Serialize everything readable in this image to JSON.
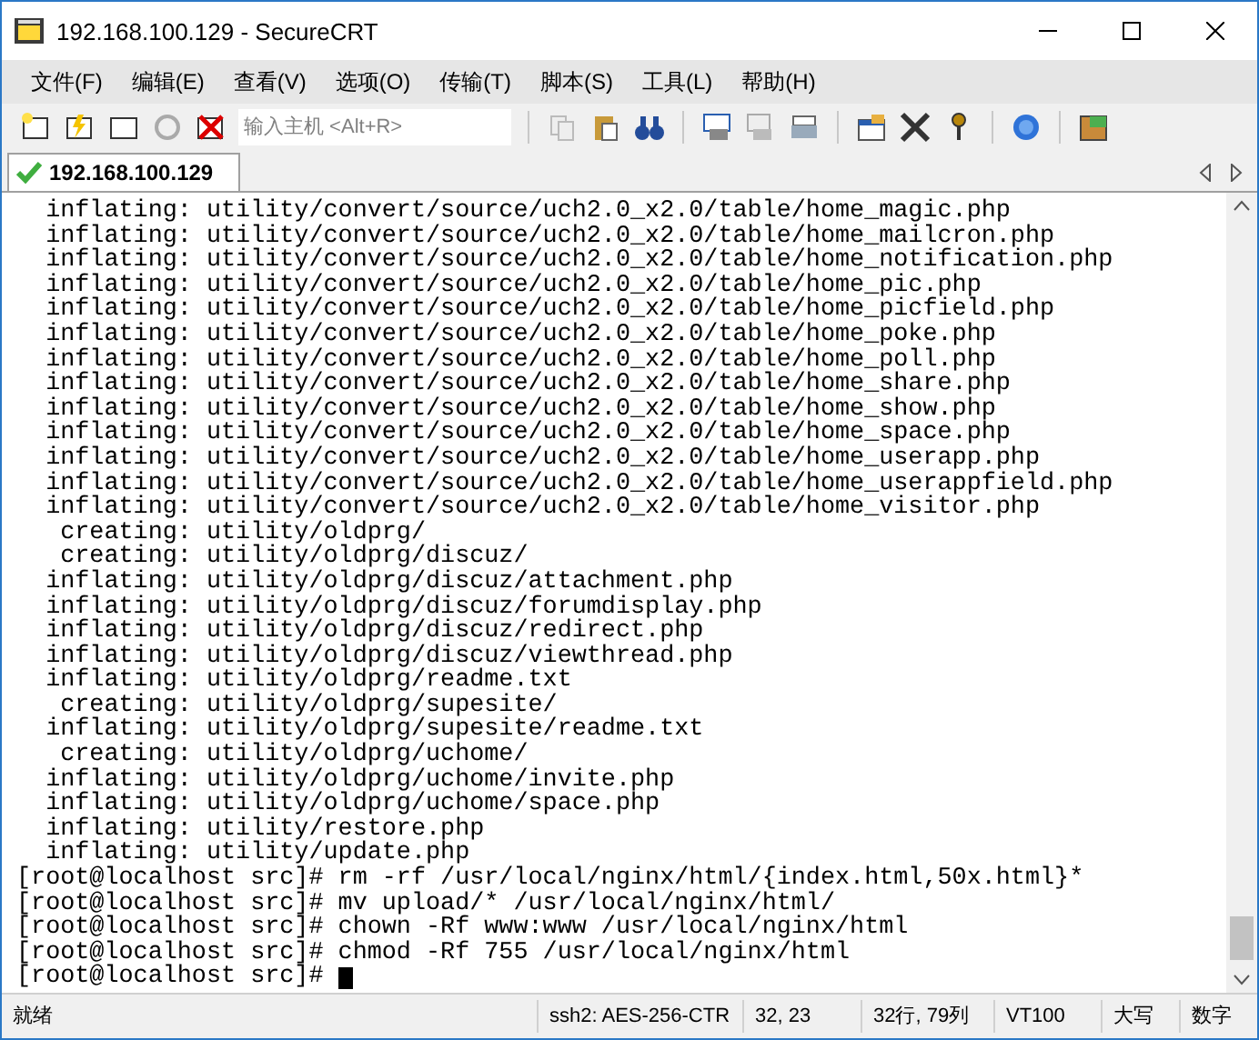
{
  "window": {
    "title": "192.168.100.129 - SecureCRT"
  },
  "menu": [
    "文件(F)",
    "编辑(E)",
    "查看(V)",
    "选项(O)",
    "传输(T)",
    "脚本(S)",
    "工具(L)",
    "帮助(H)"
  ],
  "toolbar": {
    "host_field": {
      "placeholder": "输入主机 <Alt+R>"
    }
  },
  "tabs": [
    {
      "label": "192.168.100.129",
      "selected": true,
      "connected": true
    }
  ],
  "terminal": {
    "lines": [
      "  inflating: utility/convert/source/uch2.0_x2.0/table/home_magic.php",
      "  inflating: utility/convert/source/uch2.0_x2.0/table/home_mailcron.php",
      "  inflating: utility/convert/source/uch2.0_x2.0/table/home_notification.php",
      "  inflating: utility/convert/source/uch2.0_x2.0/table/home_pic.php",
      "  inflating: utility/convert/source/uch2.0_x2.0/table/home_picfield.php",
      "  inflating: utility/convert/source/uch2.0_x2.0/table/home_poke.php",
      "  inflating: utility/convert/source/uch2.0_x2.0/table/home_poll.php",
      "  inflating: utility/convert/source/uch2.0_x2.0/table/home_share.php",
      "  inflating: utility/convert/source/uch2.0_x2.0/table/home_show.php",
      "  inflating: utility/convert/source/uch2.0_x2.0/table/home_space.php",
      "  inflating: utility/convert/source/uch2.0_x2.0/table/home_userapp.php",
      "  inflating: utility/convert/source/uch2.0_x2.0/table/home_userappfield.php",
      "  inflating: utility/convert/source/uch2.0_x2.0/table/home_visitor.php",
      "   creating: utility/oldprg/",
      "   creating: utility/oldprg/discuz/",
      "  inflating: utility/oldprg/discuz/attachment.php",
      "  inflating: utility/oldprg/discuz/forumdisplay.php",
      "  inflating: utility/oldprg/discuz/redirect.php",
      "  inflating: utility/oldprg/discuz/viewthread.php",
      "  inflating: utility/oldprg/readme.txt",
      "   creating: utility/oldprg/supesite/",
      "  inflating: utility/oldprg/supesite/readme.txt",
      "   creating: utility/oldprg/uchome/",
      "  inflating: utility/oldprg/uchome/invite.php",
      "  inflating: utility/oldprg/uchome/space.php",
      "  inflating: utility/restore.php",
      "  inflating: utility/update.php",
      "[root@localhost src]# rm -rf /usr/local/nginx/html/{index.html,50x.html}*",
      "[root@localhost src]# mv upload/* /usr/local/nginx/html/",
      "[root@localhost src]# chown -Rf www:www /usr/local/nginx/html",
      "[root@localhost src]# chmod -Rf 755 /usr/local/nginx/html",
      "[root@localhost src]# "
    ],
    "cursor": true
  },
  "status_bar": [
    "就绪",
    "ssh2: AES-256-CTR",
    "32,  23",
    "32行, 79列",
    "VT100",
    "大写",
    "数字"
  ]
}
